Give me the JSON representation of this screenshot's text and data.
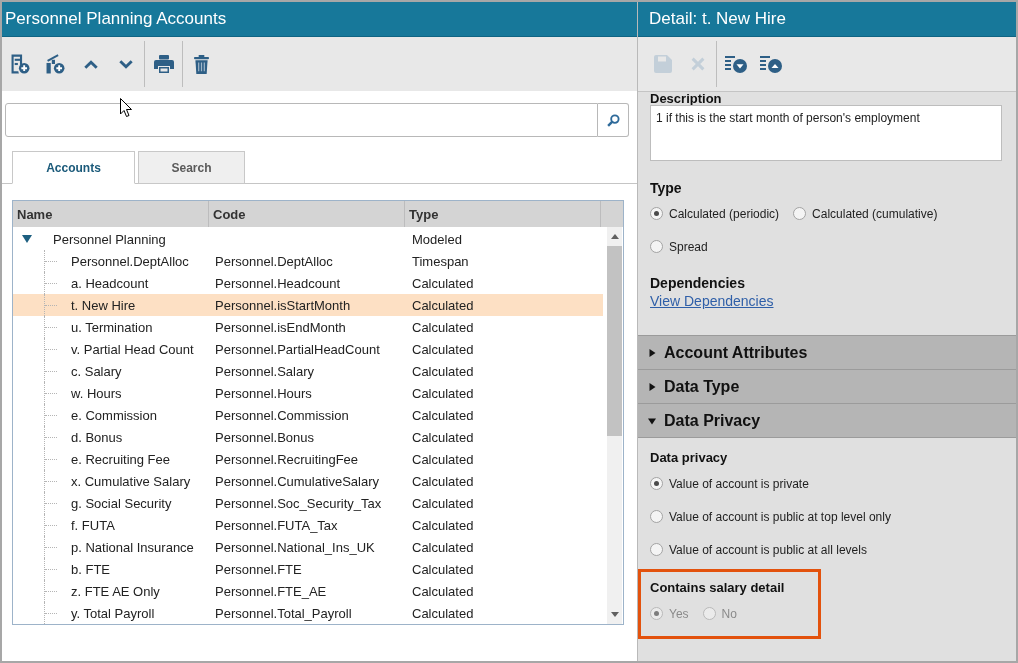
{
  "left_panel": {
    "title": "Personnel Planning Accounts",
    "toolbar": [
      [
        {
          "kind": "add-row",
          "disabled": false
        },
        {
          "kind": "add-child",
          "disabled": false
        },
        {
          "kind": "move-up",
          "disabled": false
        },
        {
          "kind": "move-down",
          "disabled": false
        }
      ],
      [
        {
          "kind": "print",
          "disabled": false
        }
      ],
      [
        {
          "kind": "delete",
          "disabled": false
        }
      ]
    ],
    "tabs": [
      {
        "label": "Accounts",
        "selected": true
      },
      {
        "label": "Search",
        "selected": false
      }
    ],
    "table": {
      "columns": [
        "Name",
        "Code",
        "Type"
      ],
      "rows": [
        {
          "name": "Personnel Planning",
          "type": "Modeled",
          "expanded": true,
          "selected": false,
          "children": [
            {
              "name": "Personnel.DeptAlloc",
              "code": "Personnel.DeptAlloc",
              "type": "Timespan",
              "selected": false
            },
            {
              "name": "a. Headcount",
              "code": "Personnel.Headcount",
              "type": "Calculated",
              "selected": false
            },
            {
              "name": "t. New Hire",
              "code": "Personnel.isStartMonth",
              "type": "Calculated",
              "selected": true
            },
            {
              "name": "u. Termination",
              "code": "Personnel.isEndMonth",
              "type": "Calculated",
              "selected": false
            },
            {
              "name": "v. Partial Head Count",
              "code": "Personnel.PartialHeadCount",
              "type": "Calculated",
              "selected": false
            },
            {
              "name": "c. Salary",
              "code": "Personnel.Salary",
              "type": "Calculated",
              "selected": false
            },
            {
              "name": "w. Hours",
              "code": "Personnel.Hours",
              "type": "Calculated",
              "selected": false
            },
            {
              "name": "e. Commission",
              "code": "Personnel.Commission",
              "type": "Calculated",
              "selected": false
            },
            {
              "name": "d. Bonus",
              "code": "Personnel.Bonus",
              "type": "Calculated",
              "selected": false
            },
            {
              "name": "e. Recruiting Fee",
              "code": "Personnel.RecruitingFee",
              "type": "Calculated",
              "selected": false
            },
            {
              "name": "x. Cumulative Salary",
              "code": "Personnel.CumulativeSalary",
              "type": "Calculated",
              "selected": false
            },
            {
              "name": "g. Social Security",
              "code": "Personnel.Soc_Security_Tax",
              "type": "Calculated",
              "selected": false
            },
            {
              "name": "f. FUTA",
              "code": "Personnel.FUTA_Tax",
              "type": "Calculated",
              "selected": false
            },
            {
              "name": "p. National Insurance",
              "code": "Personnel.National_Ins_UK",
              "type": "Calculated",
              "selected": false
            },
            {
              "name": "b. FTE",
              "code": "Personnel.FTE",
              "type": "Calculated",
              "selected": false
            },
            {
              "name": "z. FTE AE Only",
              "code": "Personnel.FTE_AE",
              "type": "Calculated",
              "selected": false
            },
            {
              "name": "y. Total Payroll",
              "code": "Personnel.Total_Payroll",
              "type": "Calculated",
              "selected": false
            }
          ]
        }
      ]
    }
  },
  "right_panel": {
    "title": "Detail: t. New Hire",
    "toolbar": [
      [
        {
          "kind": "save",
          "disabled": true
        },
        {
          "kind": "cancel",
          "disabled": true
        }
      ],
      [
        {
          "kind": "expand-all",
          "disabled": false
        },
        {
          "kind": "collapse-all",
          "disabled": false
        }
      ]
    ],
    "description": {
      "label": "Description",
      "value": "1 if this is the start month of person's employment"
    },
    "type": {
      "label": "Type",
      "options": [
        {
          "label": "Calculated (periodic)",
          "selected": true,
          "disabled": false
        },
        {
          "label": "Calculated (cumulative)",
          "selected": false,
          "disabled": false
        },
        {
          "label": "Spread",
          "selected": false,
          "disabled": false
        }
      ]
    },
    "dependencies": {
      "label": "Dependencies",
      "link": "View Dependencies"
    },
    "sections": [
      {
        "title": "Account Attributes",
        "expanded": false
      },
      {
        "title": "Data Type",
        "expanded": false
      },
      {
        "title": "Data Privacy",
        "expanded": true,
        "groups": [
          {
            "label": "Data privacy",
            "options": [
              {
                "label": "Value of account is private",
                "selected": true,
                "disabled": false
              },
              {
                "label": "Value of account is public at top level only",
                "selected": false,
                "disabled": false
              },
              {
                "label": "Value of account is public at all levels",
                "selected": false,
                "disabled": false
              }
            ]
          },
          {
            "label": "Contains salary detail",
            "highlighted": true,
            "options": [
              {
                "label": "Yes",
                "selected": true,
                "disabled": true
              },
              {
                "label": "No",
                "selected": false,
                "disabled": true
              }
            ]
          }
        ]
      }
    ]
  }
}
